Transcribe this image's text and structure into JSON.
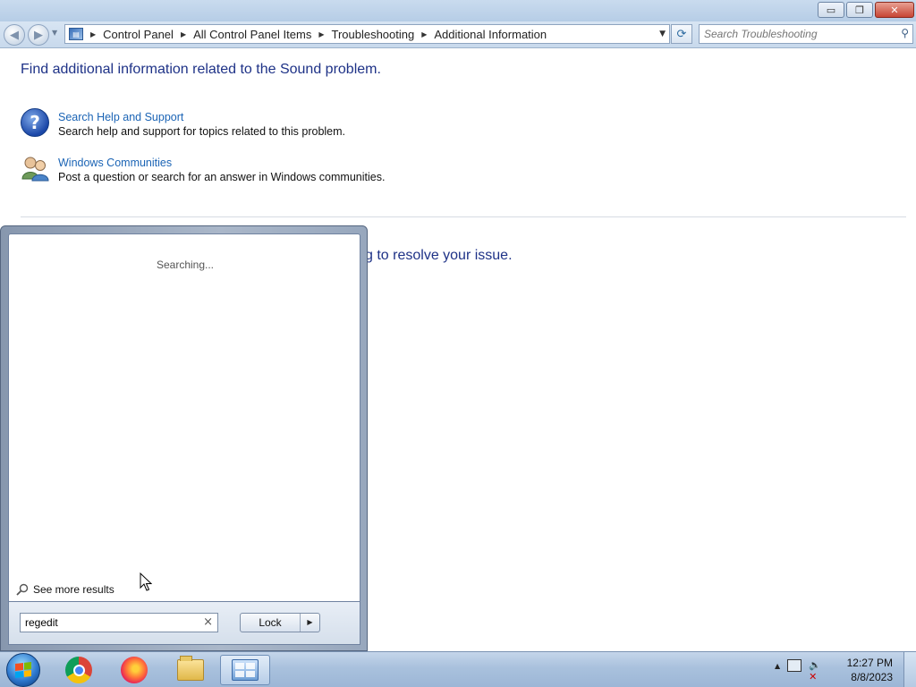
{
  "window": {
    "minimize_glyph": "▭",
    "restore_glyph": "❐",
    "close_glyph": "✕"
  },
  "navbar": {
    "back_glyph": "◀",
    "forward_glyph": "▶",
    "breadcrumbs": [
      "Control Panel",
      "All Control Panel Items",
      "Troubleshooting",
      "Additional Information"
    ],
    "search_placeholder": "Search Troubleshooting"
  },
  "content": {
    "heading": "Find additional information related to the Sound problem.",
    "items": [
      {
        "title": "Search Help and Support",
        "description": "Search help and support for topics related to this problem.",
        "icon": "help-question-icon"
      },
      {
        "title": "Windows Communities",
        "description": "Post a question or search for an answer in Windows communities.",
        "icon": "people-icon"
      }
    ],
    "partial_text": "g to resolve your issue."
  },
  "start_menu": {
    "status": "Searching...",
    "see_more": "See more results",
    "search_value": "regedit",
    "lock_label": "Lock"
  },
  "taskbar": {
    "apps": [
      "chrome-icon",
      "firefox-icon",
      "file-explorer-icon",
      "control-panel-icon"
    ],
    "time": "12:27 PM",
    "date": "8/8/2023"
  }
}
